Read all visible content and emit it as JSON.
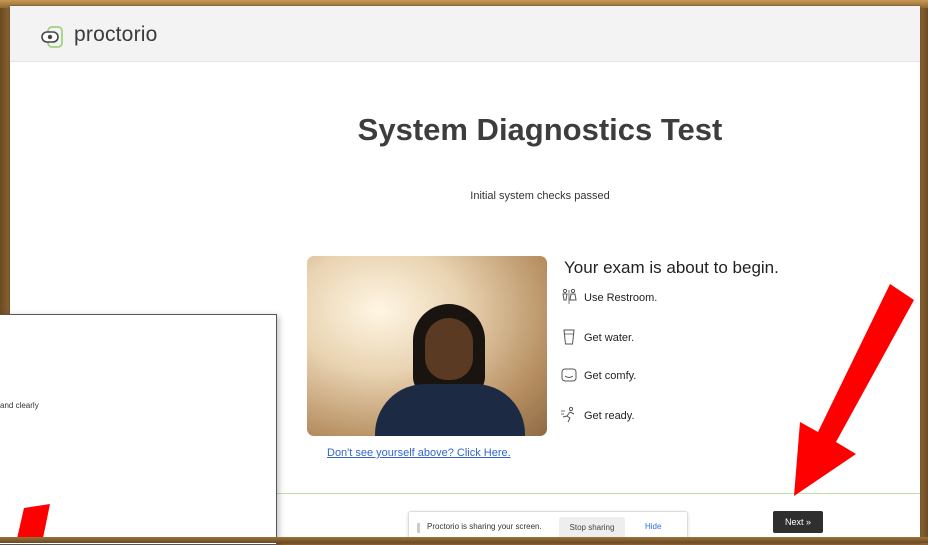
{
  "header": {
    "brand": "proctorio",
    "logo_icon": "proctorio-logo-icon"
  },
  "main": {
    "title": "System Diagnostics Test",
    "status": "Initial system checks passed",
    "webcam_help_link": "Don't see yourself above? Click Here.",
    "panel_title": "Your exam is about to begin.",
    "tips": [
      {
        "icon": "restroom-icon",
        "label": "Use Restroom."
      },
      {
        "icon": "water-cup-icon",
        "label": "Get water."
      },
      {
        "icon": "comfy-icon",
        "label": "Get comfy."
      },
      {
        "icon": "ready-icon",
        "label": "Get ready."
      }
    ]
  },
  "screen_share": {
    "message": "Proctorio is sharing your screen.",
    "stop_label": "Stop sharing",
    "hide_label": "Hide"
  },
  "footer": {
    "next_label": "Next »"
  },
  "popup": {
    "partial_text": "and clearly"
  },
  "colors": {
    "annotation_arrow": "#ff0000",
    "link": "#3366cc",
    "next_button": "#2f2f2f",
    "divider": "#bfe3a5"
  }
}
